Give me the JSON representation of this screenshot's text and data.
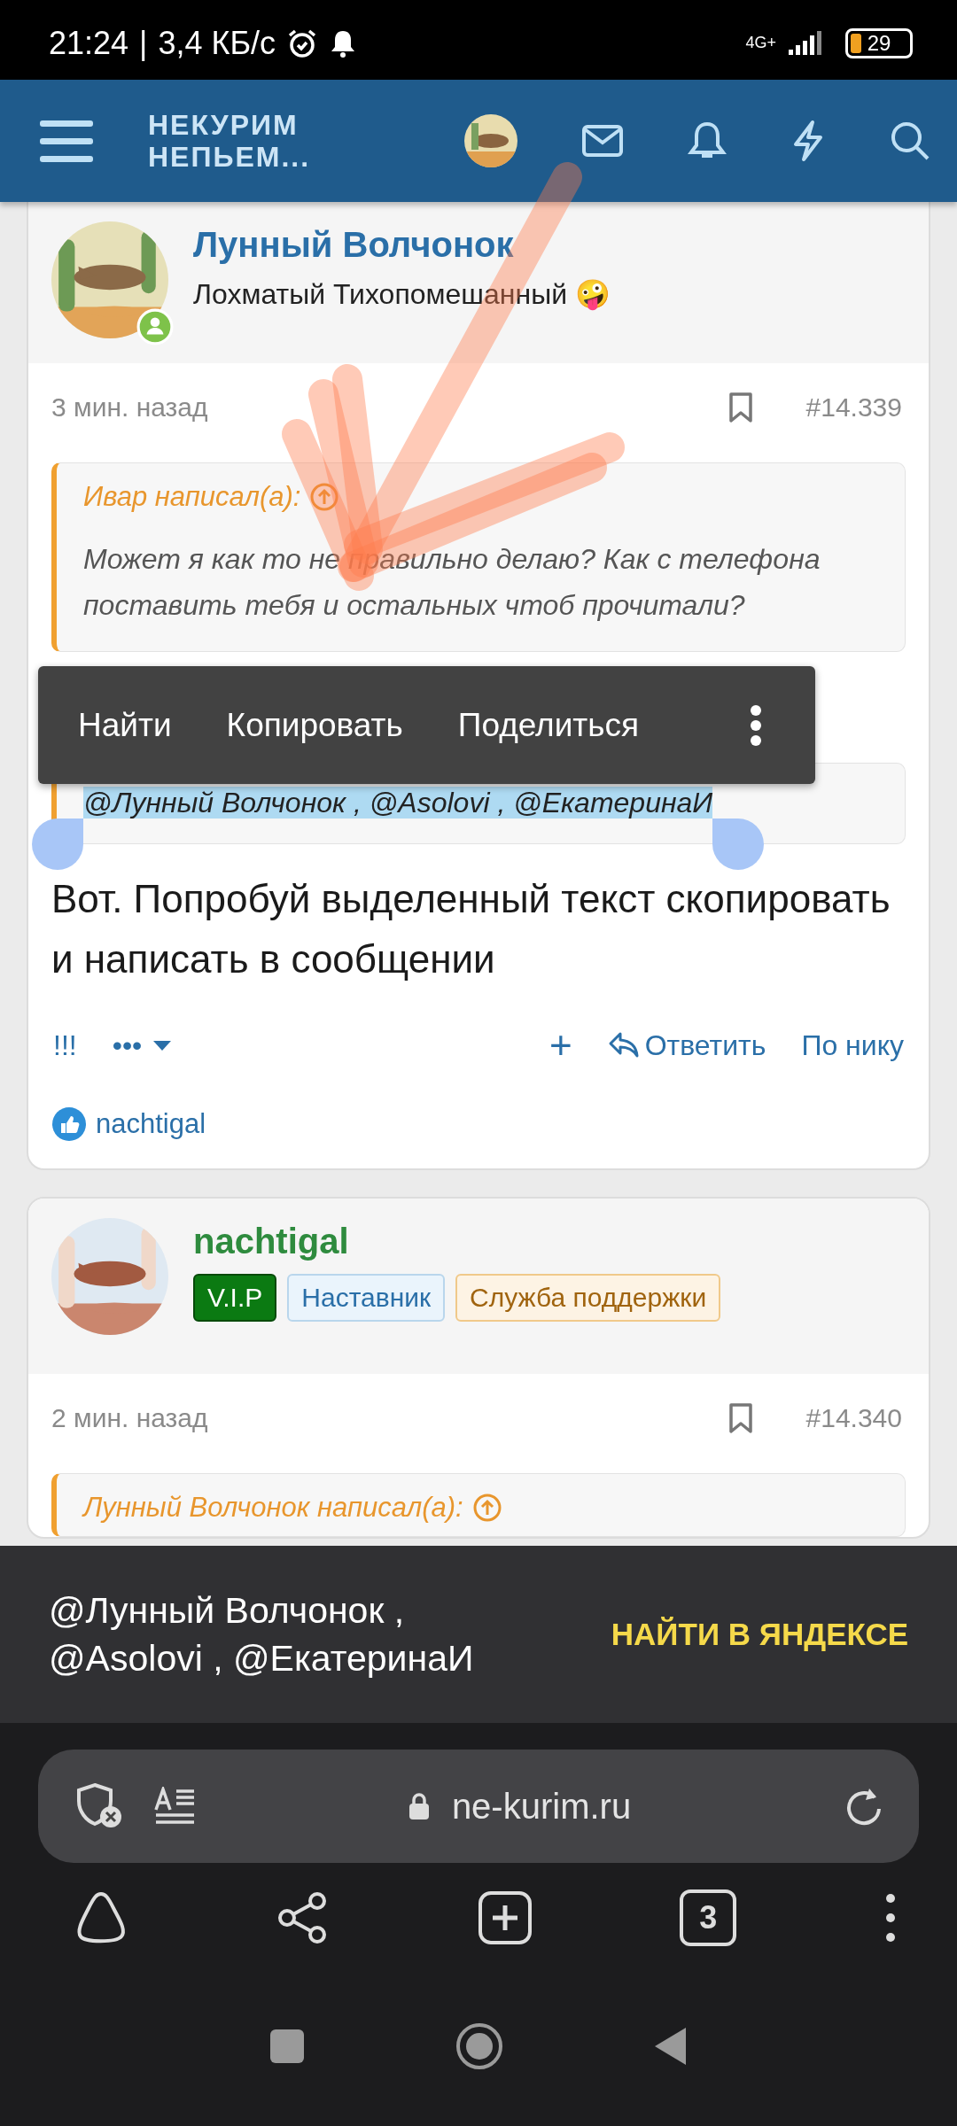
{
  "status_bar": {
    "time": "21:24",
    "separator": "|",
    "speed": "3,4 КБ/с",
    "network": "4G+",
    "battery": "29"
  },
  "header": {
    "logo_lines": [
      "НЕКУРИМ",
      "НЕПЬЕМ..."
    ]
  },
  "posts": [
    {
      "author": "Лунный Волчонок",
      "color": "#2a6fa8",
      "online": true,
      "user_title": "Лохматый Тихопомешанный 🤪",
      "time": "3 мин. назад",
      "number": "#14.339",
      "quotes": [
        {
          "author": "Ивар написал(а):",
          "text": "Может я как то не правильно делаю? Как с телефона поставить тебя и остальных чтоб прочитали?",
          "selected": false
        },
        {
          "text": "@Лунный Волчонок , @Asolovi , @ЕкатеринаИ",
          "selected": true
        }
      ],
      "body": "Вот. Попробуй выделенный текст скопировать и написать в сообщении",
      "actions": [
        {
          "kind": "text",
          "label": "!!!"
        },
        {
          "kind": "more",
          "label": "•••"
        },
        {
          "kind": "add",
          "label": "+"
        },
        {
          "kind": "reply",
          "label": "Ответить"
        },
        {
          "kind": "text",
          "label": "По нику"
        }
      ],
      "reactions": [
        {
          "user": "nachtigal"
        }
      ]
    },
    {
      "author": "nachtigal",
      "color": "#2e8b3e",
      "online": false,
      "badges": [
        {
          "label": "V.I.P",
          "kind": "vip"
        },
        {
          "label": "Наставник",
          "kind": "mentor"
        },
        {
          "label": "Служба поддержки",
          "kind": "support"
        }
      ],
      "time": "2 мин. назад",
      "number": "#14.340",
      "quotes": [
        {
          "author": "Лунный Волчонок написал(а):",
          "selected": false
        }
      ]
    }
  ],
  "selection_menu": {
    "items": [
      "Найти",
      "Копировать",
      "Поделиться"
    ]
  },
  "search_panel": {
    "query": "@Лунный Волчонок , @Asolovi , @ЕкатеринаИ",
    "action": "НАЙТИ В ЯНДЕКСЕ"
  },
  "address_bar": {
    "url": "ne-kurim.ru"
  },
  "toolbar": {
    "tabs_count": "3"
  }
}
